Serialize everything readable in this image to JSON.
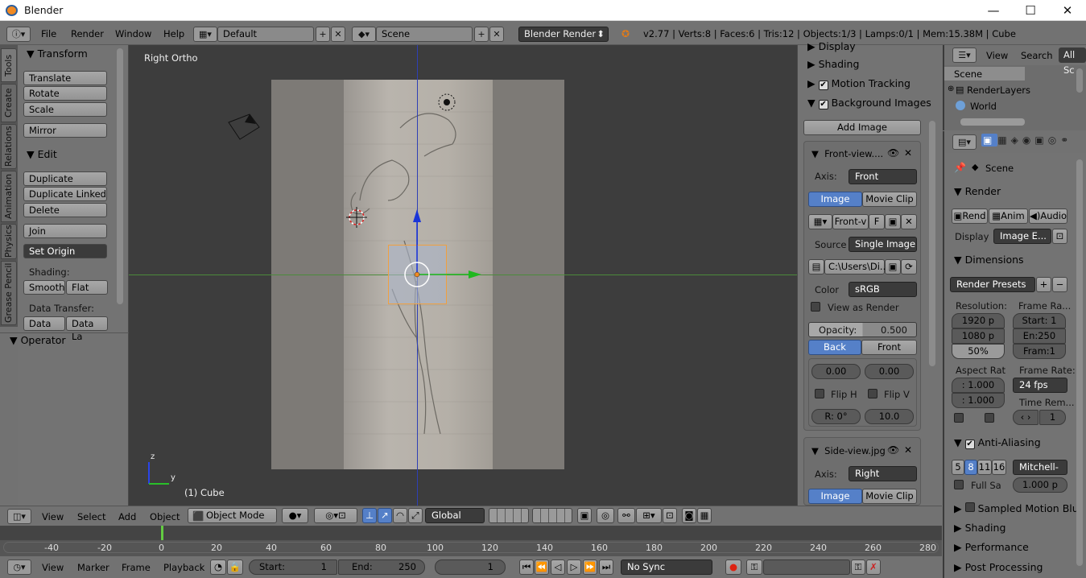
{
  "window": {
    "title": "Blender",
    "minimize": "—",
    "maximize": "☐",
    "close": "✕"
  },
  "info_header": {
    "menus": [
      "File",
      "Render",
      "Window",
      "Help"
    ],
    "screen_layout": "Default",
    "scene": "Scene",
    "render_engine": "Blender Render",
    "stats": "v2.77 | Verts:8 | Faces:6 | Tris:12 | Objects:1/3 | Lamps:0/1 | Mem:15.38M | Cube"
  },
  "tool_tabs": [
    "Tools",
    "Create",
    "Relations",
    "Animation",
    "Physics",
    "Grease Pencil"
  ],
  "toolshelf": {
    "transform_title": "Transform",
    "transform_buttons": [
      "Translate",
      "Rotate",
      "Scale"
    ],
    "mirror": "Mirror",
    "edit_title": "Edit",
    "edit_buttons": [
      "Duplicate",
      "Duplicate Linked",
      "Delete"
    ],
    "join": "Join",
    "set_origin": "Set Origin",
    "shading_label": "Shading:",
    "smooth": "Smooth",
    "flat": "Flat",
    "data_transfer_label": "Data Transfer:",
    "data": "Data",
    "data_la": "Data La",
    "operator_title": "Operator"
  },
  "viewport": {
    "view_name": "Right Ortho",
    "object_label": "(1) Cube",
    "axis_z": "z",
    "axis_y": "y"
  },
  "npanel": {
    "display": "Display",
    "shading": "Shading",
    "motion_tracking": "Motion Tracking",
    "background_images": "Background Images",
    "add_image": "Add Image",
    "bg1": {
      "name": "Front-view....",
      "axis_label": "Axis:",
      "axis": "Front",
      "image_tab": "Image",
      "movieclip_tab": "Movie Clip",
      "file_short": "Front-v",
      "f": "F",
      "source_label": "Source",
      "source": "Single Image",
      "path": "C:\\Users\\Di...",
      "color_label": "Color",
      "color": "sRGB",
      "view_as_render": "View as Render",
      "opacity_label": "Opacity:",
      "opacity": "0.500",
      "back": "Back",
      "front": "Front",
      "x": "0.00",
      "y": "0.00",
      "flip_h": "Flip H",
      "flip_v": "Flip V",
      "rotation": "R: 0°",
      "size": "10.0"
    },
    "bg2": {
      "name": "Side-view.jpg",
      "axis_label": "Axis:",
      "axis": "Right",
      "image_tab": "Image",
      "movieclip_tab": "Movie Clip"
    }
  },
  "outliner": {
    "view": "View",
    "search": "Search",
    "all_scenes": "All Sc",
    "items": [
      "Scene",
      "RenderLayers",
      "World"
    ]
  },
  "properties": {
    "breadcrumb": "Scene",
    "render_title": "Render",
    "rend": "Rend",
    "anim": "Anim",
    "audio": "Audio",
    "display_label": "Display",
    "display_value": "Image E...",
    "dimensions_title": "Dimensions",
    "render_presets": "Render Presets",
    "resolution_label": "Resolution:",
    "res_x": "1920 p",
    "res_y": "1080 p",
    "res_pct": "50%",
    "frame_range_label": "Frame Ra...",
    "start": "Start: 1",
    "end": "En:250",
    "frame_step": "Fram:1",
    "aspect_label": "Aspect Rat",
    "aspect_x": ": 1.000",
    "aspect_y": ": 1.000",
    "frame_rate_label": "Frame Rate:",
    "fps": "24 fps",
    "time_remap_label": "Time Rem...",
    "time_remap_new": "1",
    "aa_title": "Anti-Aliasing",
    "aa_samples": [
      "5",
      "8",
      "11",
      "16"
    ],
    "aa_filter": "Mitchell-",
    "full_sample": "Full Sa",
    "filter_size": "1.000 p",
    "sampled_motion_blur": "Sampled Motion Blur",
    "shading": "Shading",
    "performance": "Performance",
    "post_processing": "Post Processing"
  },
  "view3d_header": {
    "view": "View",
    "select": "Select",
    "add": "Add",
    "object": "Object",
    "mode": "Object Mode",
    "orientation": "Global"
  },
  "timeline": {
    "ticks": [
      "-40",
      "-20",
      "0",
      "20",
      "40",
      "60",
      "80",
      "100",
      "120",
      "140",
      "160",
      "180",
      "200",
      "220",
      "240",
      "260",
      "280"
    ]
  },
  "timeline_header": {
    "view": "View",
    "marker": "Marker",
    "frame": "Frame",
    "playback": "Playback",
    "start": "Start:",
    "start_val": "1",
    "end": "End:",
    "end_val": "250",
    "current": "1",
    "sync": "No Sync"
  }
}
